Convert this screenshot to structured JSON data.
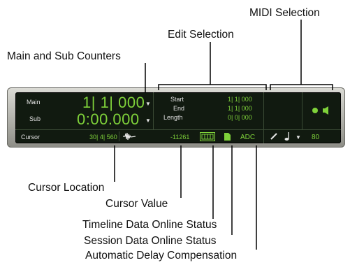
{
  "callouts": {
    "midi_selection": "MIDI Selection",
    "edit_selection": "Edit Selection",
    "main_sub_counters": "Main and Sub Counters",
    "cursor_location": "Cursor Location",
    "cursor_value": "Cursor Value",
    "timeline_status": "Timeline Data Online Status",
    "session_status": "Session Data Online Status",
    "adc": "Automatic Delay Compensation"
  },
  "counters": {
    "main_label": "Main",
    "main_value": "1| 1| 000",
    "sub_label": "Sub",
    "sub_value": "0:00.000"
  },
  "edit": {
    "start_label": "Start",
    "end_label": "End",
    "length_label": "Length",
    "start_value": "1| 1| 000",
    "end_value": "1| 1| 000",
    "length_value": "0| 0| 000"
  },
  "status_bar": {
    "cursor_label": "Cursor",
    "cursor_location": "30| 4| 560",
    "cursor_value": "-11261",
    "adc_label": "ADC",
    "tempo_value": "80"
  },
  "icons": {
    "waveform": "waveform-icon",
    "timeline_data": "timeline-data-icon",
    "session_data": "session-data-icon",
    "pencil": "pencil-icon",
    "note": "note-icon",
    "midi_indicator": "midi-indicator-icon"
  },
  "colors": {
    "lcd_background": "#111a10",
    "lcd_green": "#7fd23a",
    "lcd_text": "#e6e6e6",
    "panel": "#c8c8c0"
  }
}
